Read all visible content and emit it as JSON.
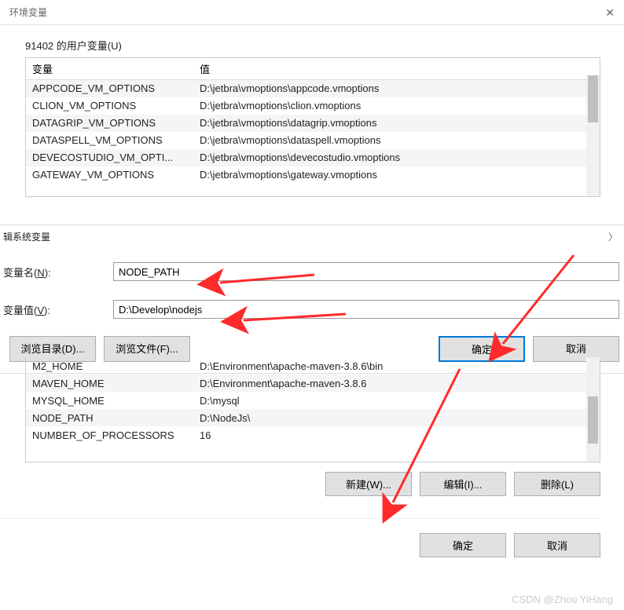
{
  "window": {
    "title": "环境变量"
  },
  "user_vars": {
    "section_label": "91402 的用户变量(U)",
    "headers": {
      "var": "变量",
      "val": "值"
    },
    "rows": [
      {
        "var": "APPCODE_VM_OPTIONS",
        "val": "D:\\jetbra\\vmoptions\\appcode.vmoptions"
      },
      {
        "var": "CLION_VM_OPTIONS",
        "val": "D:\\jetbra\\vmoptions\\clion.vmoptions"
      },
      {
        "var": "DATAGRIP_VM_OPTIONS",
        "val": "D:\\jetbra\\vmoptions\\datagrip.vmoptions"
      },
      {
        "var": "DATASPELL_VM_OPTIONS",
        "val": "D:\\jetbra\\vmoptions\\dataspell.vmoptions"
      },
      {
        "var": "DEVECOSTUDIO_VM_OPTI...",
        "val": "D:\\jetbra\\vmoptions\\devecostudio.vmoptions"
      },
      {
        "var": "GATEWAY_VM_OPTIONS",
        "val": "D:\\jetbra\\vmoptions\\gateway.vmoptions"
      }
    ]
  },
  "edit_dialog": {
    "title": "辑系统变量",
    "name_label": "变量名(N):",
    "name_value": "NODE_PATH",
    "value_label": "变量值(V):",
    "value_value": "D:\\Develop\\nodejs",
    "browse_dir": "浏览目录(D)...",
    "browse_file": "浏览文件(F)...",
    "ok": "确定",
    "cancel": "取消"
  },
  "sys_vars": {
    "rows": [
      {
        "var": "M2_HOME",
        "val": "D:\\Environment\\apache-maven-3.8.6\\bin"
      },
      {
        "var": "MAVEN_HOME",
        "val": "D:\\Environment\\apache-maven-3.8.6"
      },
      {
        "var": "MYSQL_HOME",
        "val": "D:\\mysql"
      },
      {
        "var": "NODE_PATH",
        "val": "D:\\NodeJs\\"
      },
      {
        "var": "NUMBER_OF_PROCESSORS",
        "val": "16"
      }
    ],
    "buttons": {
      "new": "新建(W)...",
      "edit": "编辑(I)...",
      "delete": "删除(L)"
    }
  },
  "final": {
    "ok": "确定",
    "cancel": "取消"
  },
  "watermark": "CSDN @Zhou YiHang"
}
